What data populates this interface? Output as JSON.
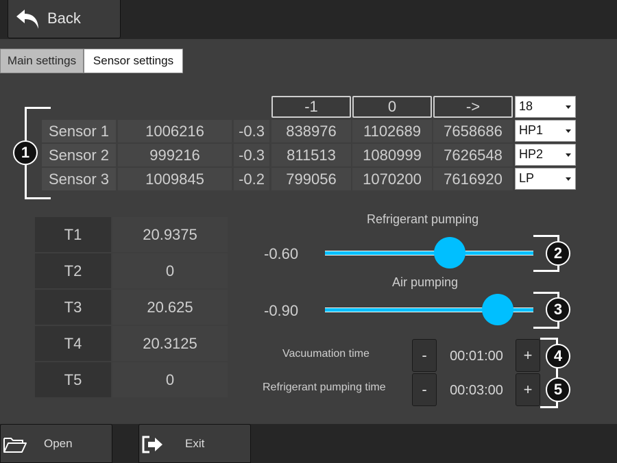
{
  "header": {
    "back_label": "Back"
  },
  "tabs": [
    {
      "label": "Main settings",
      "active": false
    },
    {
      "label": "Sensor settings",
      "active": true
    }
  ],
  "sensor_table": {
    "column_headers": [
      "-1",
      "0",
      "->"
    ],
    "header_select": "18",
    "rows": [
      {
        "name": "Sensor 1",
        "raw": "1006216",
        "offset": "-0.3",
        "v1": "838976",
        "v2": "1102689",
        "v3": "7658686",
        "type": "HP1"
      },
      {
        "name": "Sensor 2",
        "raw": "999216",
        "offset": "-0.3",
        "v1": "811513",
        "v2": "1080999",
        "v3": "7626548",
        "type": "HP2"
      },
      {
        "name": "Sensor 3",
        "raw": "1009845",
        "offset": "-0.2",
        "v1": "799056",
        "v2": "1070200",
        "v3": "7616920",
        "type": "LP"
      }
    ]
  },
  "temperatures": [
    {
      "label": "T1",
      "value": "20.9375"
    },
    {
      "label": "T2",
      "value": "0"
    },
    {
      "label": "T3",
      "value": "20.625"
    },
    {
      "label": "T4",
      "value": "20.3125"
    },
    {
      "label": "T5",
      "value": "0"
    }
  ],
  "sliders": {
    "refrigerant": {
      "title": "Refrigerant pumping",
      "value": "-0.60",
      "position_fraction": 0.6
    },
    "air": {
      "title": "Air pumping",
      "value": "-0.90",
      "position_fraction": 0.83
    }
  },
  "timers": {
    "vacuumation": {
      "label": "Vacuumation time",
      "value": "00:01:00"
    },
    "refrigerant": {
      "label": "Refrigerant pumping time",
      "value": "00:03:00"
    },
    "minus_label": "-",
    "plus_label": "+"
  },
  "callouts": [
    "1",
    "2",
    "3",
    "4",
    "5"
  ],
  "footer": {
    "open_label": "Open",
    "exit_label": "Exit"
  },
  "colors": {
    "accent": "#00bfff",
    "background": "#3e3e3e",
    "bar": "#262626"
  }
}
